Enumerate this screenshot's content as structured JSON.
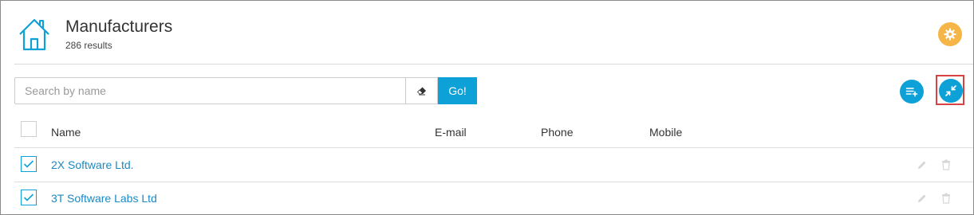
{
  "header": {
    "title": "Manufacturers",
    "subtitle": "286 results",
    "accent": "#0ea1d8",
    "settings_color": "#f5b547"
  },
  "search": {
    "placeholder": "Search by name",
    "value": "",
    "go_label": "Go!"
  },
  "table": {
    "columns": [
      "Name",
      "E-mail",
      "Phone",
      "Mobile"
    ],
    "rows": [
      {
        "name": "2X Software Ltd.",
        "email": "",
        "phone": "",
        "mobile": "",
        "checked": true
      },
      {
        "name": "3T Software Labs Ltd",
        "email": "",
        "phone": "",
        "mobile": "",
        "checked": true
      }
    ]
  },
  "icons": {
    "home": "home-icon",
    "settings": "gear-icon",
    "clear": "eraser-icon",
    "add_list": "list-add-icon",
    "compress": "compress-icon",
    "edit": "pencil-icon",
    "delete": "trash-icon"
  }
}
